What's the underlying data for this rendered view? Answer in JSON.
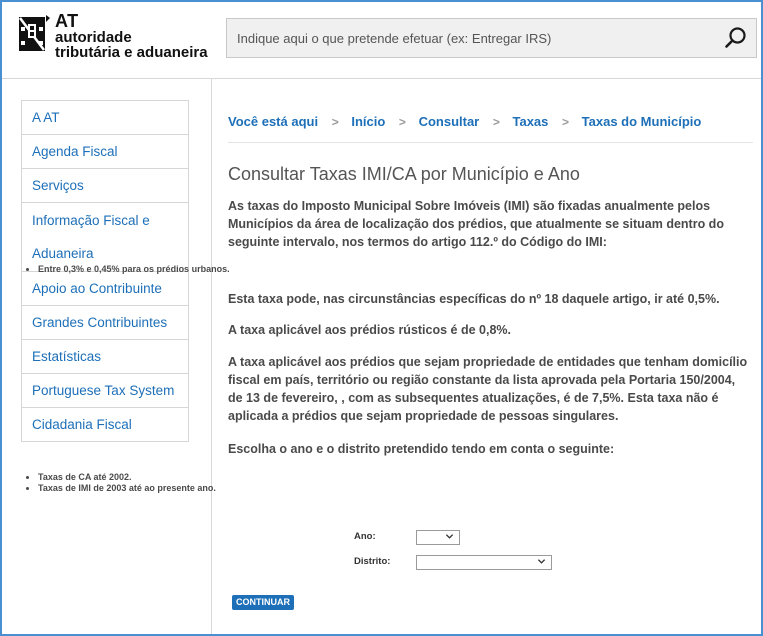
{
  "header": {
    "logo": {
      "line1": "AT",
      "line2": "autoridade",
      "line3": "tributária e aduaneira"
    },
    "search": {
      "placeholder": "Indique aqui o que pretende efetuar (ex: Entregar IRS)",
      "icon": "search-icon"
    }
  },
  "sidebar": {
    "items": [
      {
        "label": "A AT"
      },
      {
        "label": "Agenda Fiscal"
      },
      {
        "label": "Serviços"
      },
      {
        "label_line1": "Informação Fiscal e",
        "label_line2": "Aduaneira"
      },
      {
        "label": "Apoio ao Contribuinte"
      },
      {
        "label": "Grandes Contribuintes"
      },
      {
        "label": "Estatísticas"
      },
      {
        "label": "Portuguese Tax System"
      },
      {
        "label": "Cidadania Fiscal"
      }
    ]
  },
  "breadcrumb": {
    "prefix": "Você está aqui",
    "items": [
      "Início",
      "Consultar",
      "Taxas",
      "Taxas do Município"
    ],
    "separator": ">"
  },
  "main": {
    "title": "Consultar Taxas IMI/CA por Município e Ano",
    "intro": "As taxas do Imposto Municipal Sobre Imóveis (IMI) são fixadas anualmente pelos Municípios da área de localização dos prédios, que atualmente se situam dentro do seguinte intervalo, nos termos do artigo 112.º do Código do IMI:",
    "intro_bullets": [
      "Entre 0,3% e 0,45% para os prédios urbanos."
    ],
    "para2": "Esta taxa pode, nas circunstâncias específicas do nº 18 daquele artigo, ir até 0,5%.",
    "para3": "A taxa aplicável aos prédios rústicos é de 0,8%.",
    "para4": "A taxa aplicável aos prédios que sejam propriedade de entidades que tenham domicílio fiscal em país, território ou região constante da lista aprovada pela Portaria 150/2004, de 13 de fevereiro, , com as subsequentes atualizações, é de 7,5%. Esta taxa não é aplicada a prédios que sejam propriedade de pessoas singulares.",
    "para5": "Escolha o ano e o distrito pretendido tendo em conta o seguinte:",
    "choice_bullets": [
      "Taxas de CA até 2002.",
      "Taxas de IMI de 2003 até ao presente ano."
    ]
  },
  "form": {
    "ano_label": "Ano:",
    "ano_value": "",
    "distrito_label": "Distrito:",
    "distrito_value": "",
    "submit_label": "CONTINUAR"
  },
  "colors": {
    "link": "#1d6fb8",
    "frame": "#4a8fd0",
    "text": "#4a4a4a"
  }
}
